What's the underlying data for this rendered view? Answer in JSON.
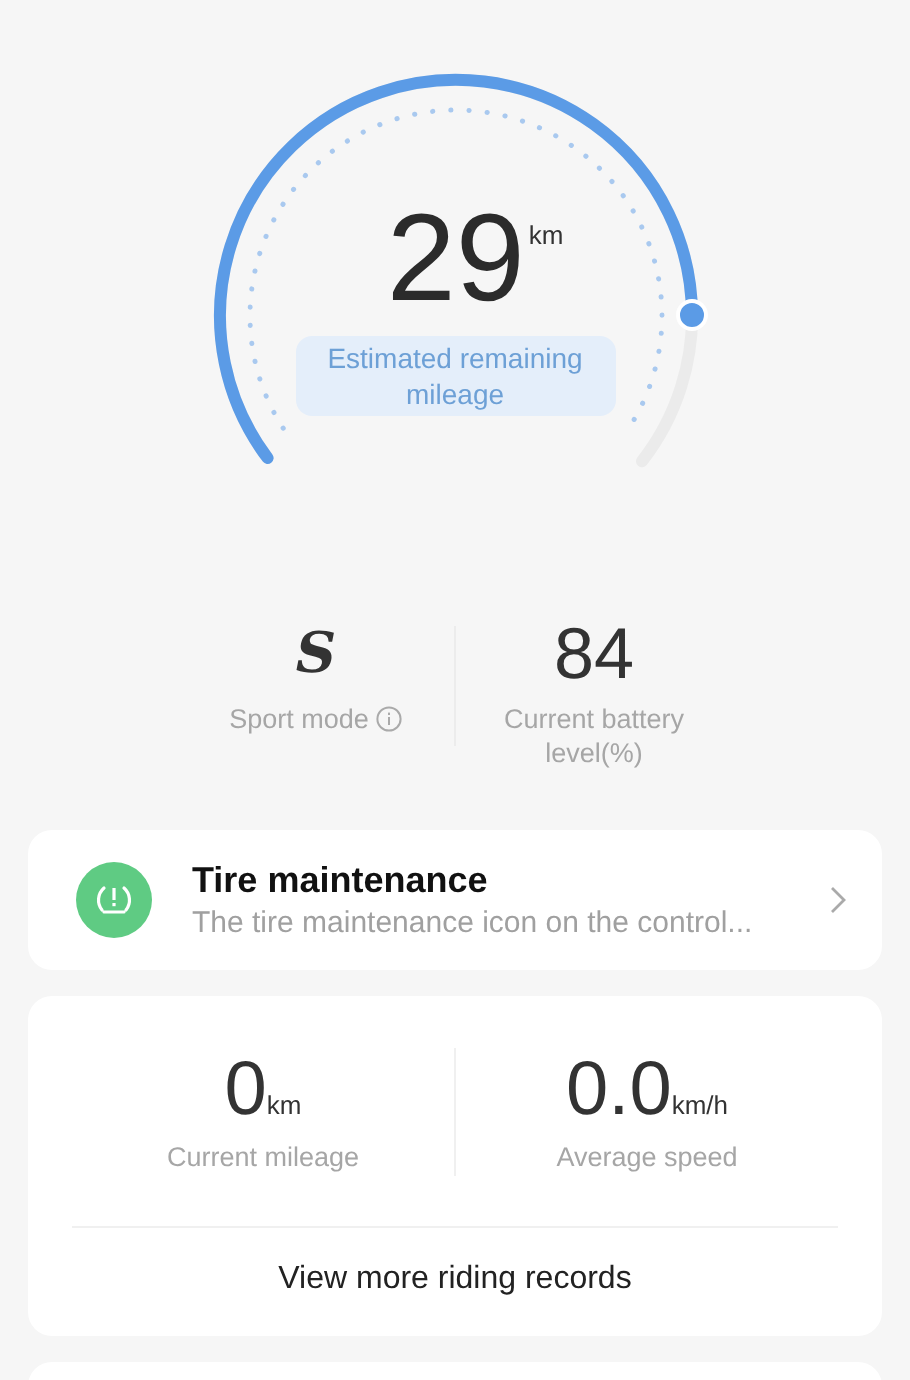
{
  "gauge": {
    "value": "29",
    "unit": "km",
    "label": "Estimated remaining mileage"
  },
  "stats": [
    {
      "kind": "mode",
      "value": "S",
      "label": "Sport mode",
      "info": true
    },
    {
      "kind": "number",
      "value": "84",
      "label": "Current battery level(%)",
      "info": false
    }
  ],
  "notice": {
    "title": "Tire maintenance",
    "text": "The tire maintenance icon on the control..."
  },
  "riding": {
    "metrics": [
      {
        "value": "0",
        "unit": "km",
        "label": "Current mileage"
      },
      {
        "value": "0.0",
        "unit": "km/h",
        "label": "Average speed"
      }
    ],
    "link": "View more riding records"
  }
}
